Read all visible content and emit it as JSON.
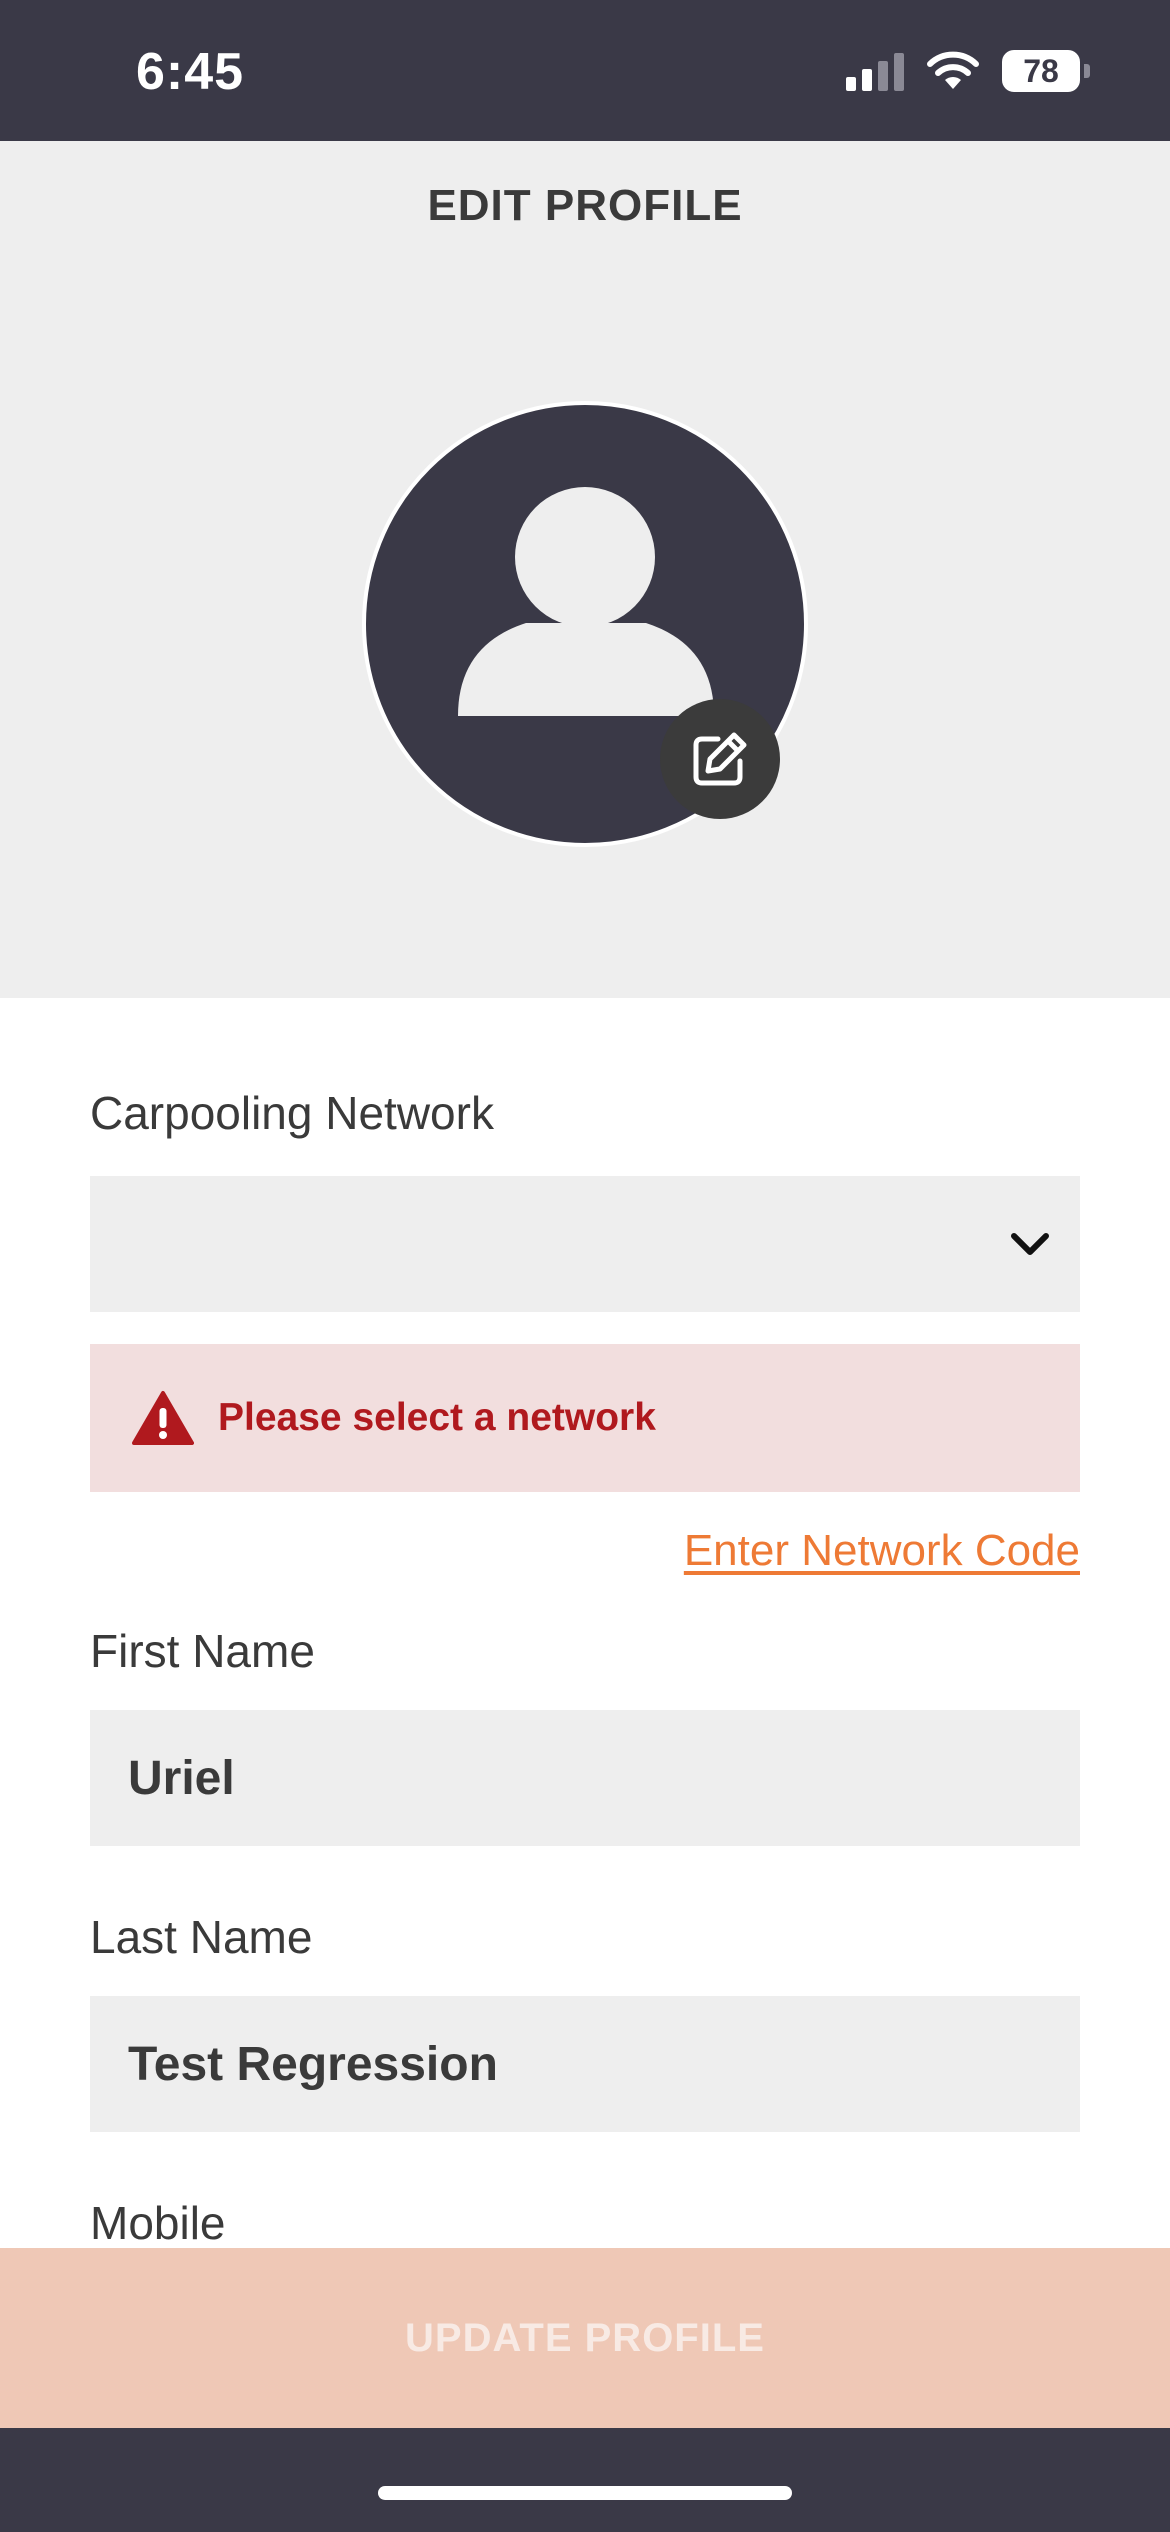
{
  "status_bar": {
    "time": "6:45",
    "battery": "78"
  },
  "header": {
    "title": "EDIT PROFILE"
  },
  "form": {
    "network": {
      "label": "Carpooling Network",
      "value": ""
    },
    "error": {
      "message": "Please select a network"
    },
    "network_code_link": "Enter Network Code",
    "first_name": {
      "label": "First Name",
      "value": "Uriel"
    },
    "last_name": {
      "label": "Last Name",
      "value": "Test Regression"
    },
    "mobile": {
      "label": "Mobile"
    }
  },
  "actions": {
    "update_label": "UPDATE PROFILE"
  },
  "colors": {
    "dark": "#3a3947",
    "accent_link": "#ee7a35",
    "error_bg": "#f2dede",
    "error_text": "#b0191e",
    "button_disabled": "#efc8b6"
  }
}
